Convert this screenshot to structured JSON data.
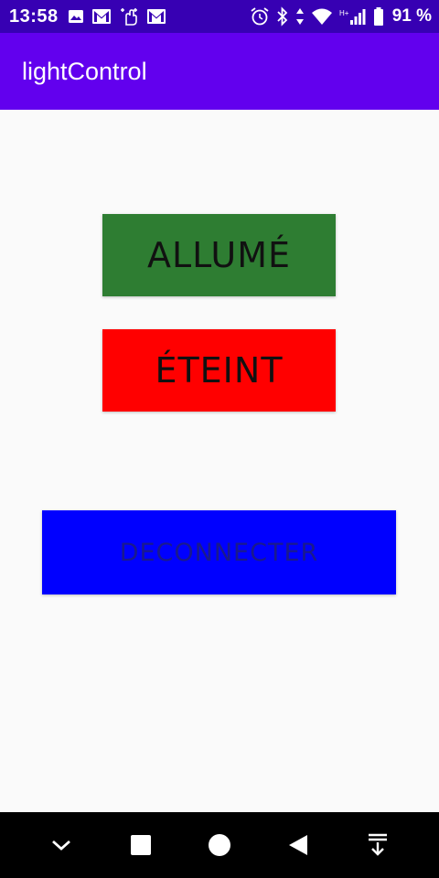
{
  "status_bar": {
    "time": "13:58",
    "battery_text": "91 %",
    "left_icons": [
      "image-icon",
      "gmail-icon",
      "swipe-hand-icon",
      "gmail-icon"
    ],
    "right_icons": [
      "alarm-icon",
      "bluetooth-icon",
      "data-arrows-icon",
      "wifi-icon",
      "signal-icon",
      "battery-icon"
    ],
    "network_label": "H+",
    "color": "#3700b3"
  },
  "app_bar": {
    "title": "lightControl",
    "color": "#6200ee"
  },
  "buttons": {
    "on_label": "ALLUMÉ",
    "on_color": "#2e7d32",
    "off_label": "ÉTEINT",
    "off_color": "#ff0000",
    "disconnect_label": "DECONNECTER",
    "disconnect_color": "#0000ff"
  },
  "nav_bar": {
    "icons": [
      "chevron-down-icon",
      "recents-square-icon",
      "home-circle-icon",
      "back-triangle-icon",
      "notifications-pull-icon"
    ]
  }
}
